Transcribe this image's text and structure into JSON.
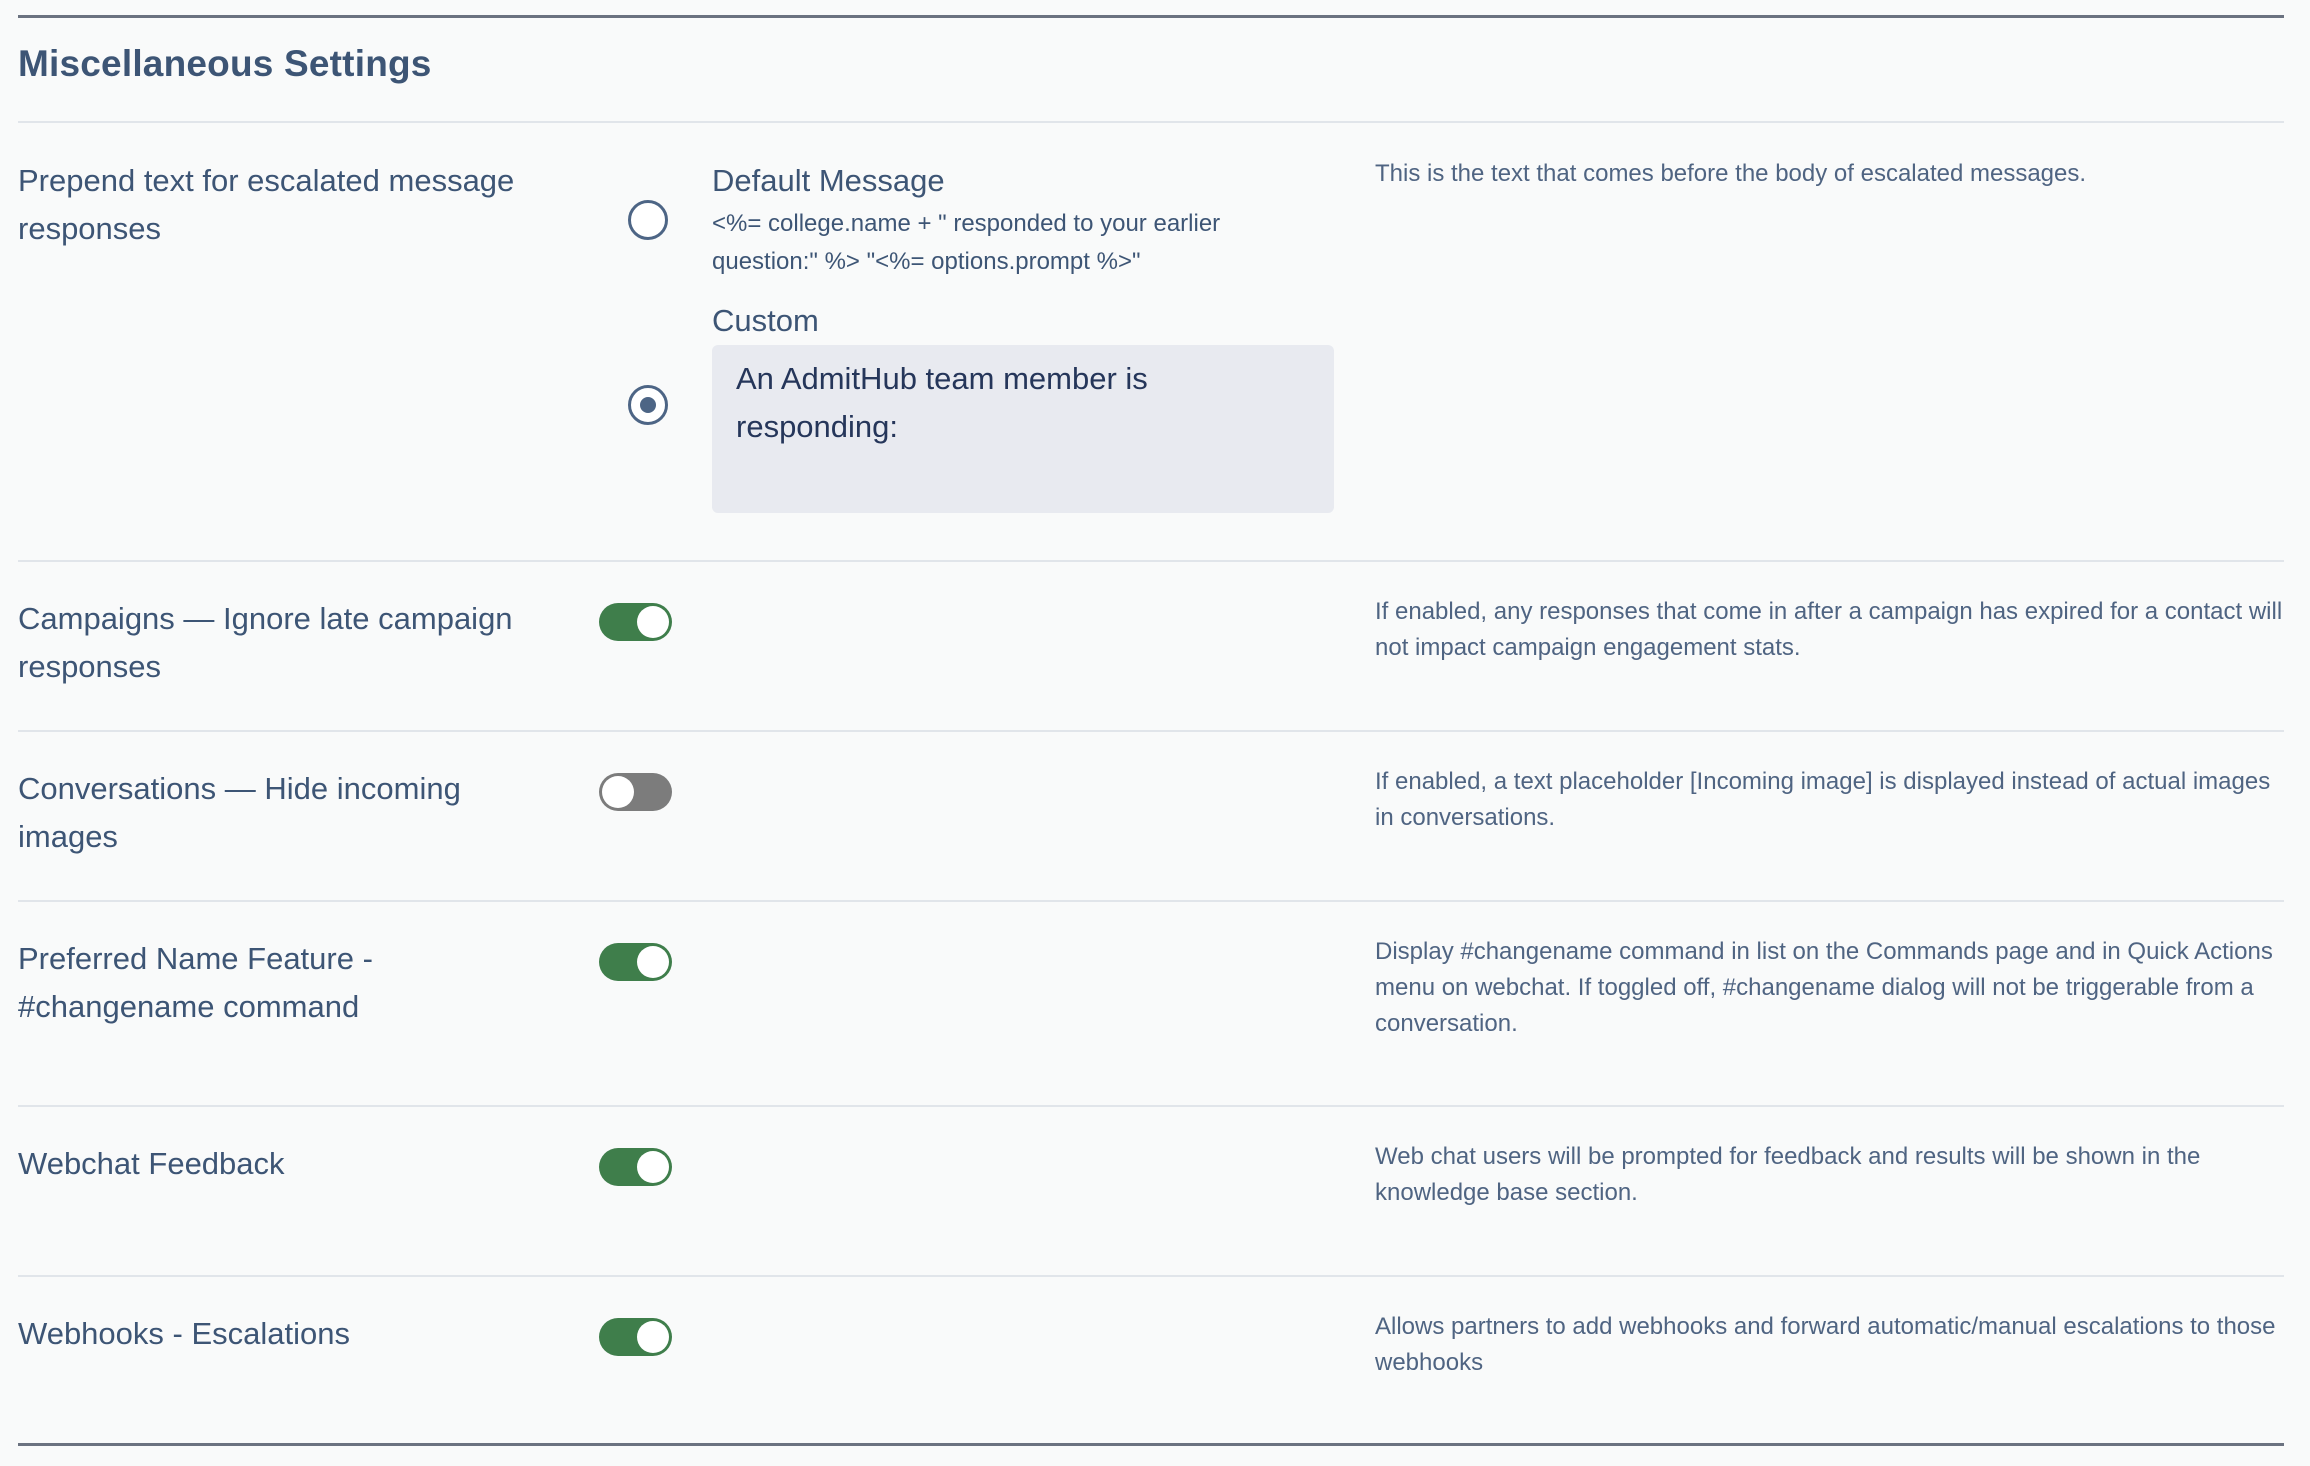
{
  "section": {
    "title": "Miscellaneous Settings"
  },
  "prepend": {
    "label": "Prepend text for escalated message responses",
    "default_option": {
      "title": "Default Message",
      "template": "<%= college.name + \" responded to your earlier question:\" %> \"<%= options.prompt %>\"",
      "selected": false
    },
    "custom_option": {
      "title": "Custom",
      "value": "An AdmitHub team member is responding:",
      "selected": true
    },
    "description": "This is the text that comes before the body of escalated messages."
  },
  "settings": [
    {
      "label": "Campaigns — Ignore late campaign responses",
      "enabled": true,
      "description": "If enabled, any responses that come in after a campaign has expired for a contact will not impact campaign engagement stats."
    },
    {
      "label": "Conversations — Hide incoming images",
      "enabled": false,
      "description": "If enabled, a text placeholder [Incoming image] is displayed instead of actual images in conversations."
    },
    {
      "label": "Preferred Name Feature - #changename command",
      "enabled": true,
      "description": "Display #changename command in list on the Commands page and in Quick Actions menu on webchat. If toggled off, #changename dialog will not be triggerable from a conversation."
    },
    {
      "label": "Webchat Feedback",
      "enabled": true,
      "description": "Web chat users will be prompted for feedback and results will be shown in the knowledge base section."
    },
    {
      "label": "Webhooks - Escalations",
      "enabled": true,
      "description": "Allows partners to add webhooks and forward automatic/manual escalations to those webhooks"
    }
  ],
  "colors": {
    "toggle_on": "#3f7e4b",
    "toggle_off": "#7c7c7c",
    "text": "#3d5575",
    "field_bg": "#e8eaf0"
  }
}
